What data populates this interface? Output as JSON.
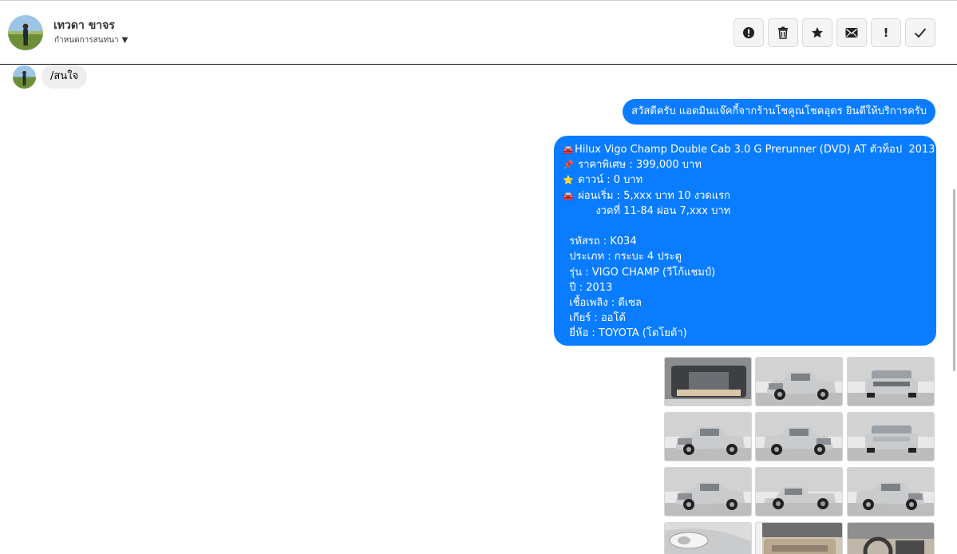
{
  "header": {
    "contact_name": "เทวดา ขาจร",
    "label_action": "กำหนดการสนทนา",
    "avatar_icon": "user-avatar-photo",
    "toolbar_icons": [
      "alert-circle-icon",
      "trash-icon",
      "star-icon",
      "mail-icon",
      "exclamation-icon",
      "check-icon"
    ],
    "toolbar_exclaim": "!"
  },
  "chat": {
    "incoming": {
      "text": "/สนใจ"
    },
    "outgoing_greeting": "สวัสดีครับ แอดมินแจ๊คกี้จากร้านโชคูณโชคอุดร ยินดีให้บริการครับ",
    "details": {
      "lines": [
        {
          "emoji": "🚘",
          "text": "Hilux Vigo Champ Double Cab 3.0 G Prerunner (DVD) AT ตัวท็อป  2013"
        },
        {
          "emoji": "📌",
          "text": " ราคาพิเศษ : 399,000 บาท"
        },
        {
          "emoji": "⭐",
          "text": " ดาวน์ : 0 บาท"
        },
        {
          "emoji": "🚘",
          "text": " ผ่อนเริ่ม : 5,xxx บาท 10 งวดแรก"
        },
        {
          "emoji": "",
          "text": "          งวดที่ 11-84 ผ่อน 7,xxx บาท"
        },
        {
          "emoji": "",
          "text": ""
        },
        {
          "emoji": "",
          "text": "  รหัสรถ : K034"
        },
        {
          "emoji": "",
          "text": "  ประเภท : กระบะ 4 ประตู"
        },
        {
          "emoji": "",
          "text": "  รุ่น : VIGO CHAMP (วีโก้แชมป์)"
        },
        {
          "emoji": "",
          "text": "  ปี : 2013"
        },
        {
          "emoji": "",
          "text": "  เชื้อเพลิง : ดีเซล"
        },
        {
          "emoji": "",
          "text": "  เกียร์ : ออโต้"
        },
        {
          "emoji": "",
          "text": "  ยี่ห้อ : TOYOTA (โตโยต้า)"
        }
      ]
    },
    "photos": [
      {
        "kind": "engine"
      },
      {
        "kind": "front-left"
      },
      {
        "kind": "front"
      },
      {
        "kind": "front-left"
      },
      {
        "kind": "rear-right"
      },
      {
        "kind": "rear"
      },
      {
        "kind": "rear-left"
      },
      {
        "kind": "side"
      },
      {
        "kind": "front-right"
      },
      {
        "kind": "headlight"
      },
      {
        "kind": "interior-door"
      },
      {
        "kind": "dashboard"
      }
    ]
  },
  "colors": {
    "outgoing_bubble": "#0a7cff",
    "incoming_bubble": "#eeeeee",
    "car_silver": "#c9cbcd"
  }
}
